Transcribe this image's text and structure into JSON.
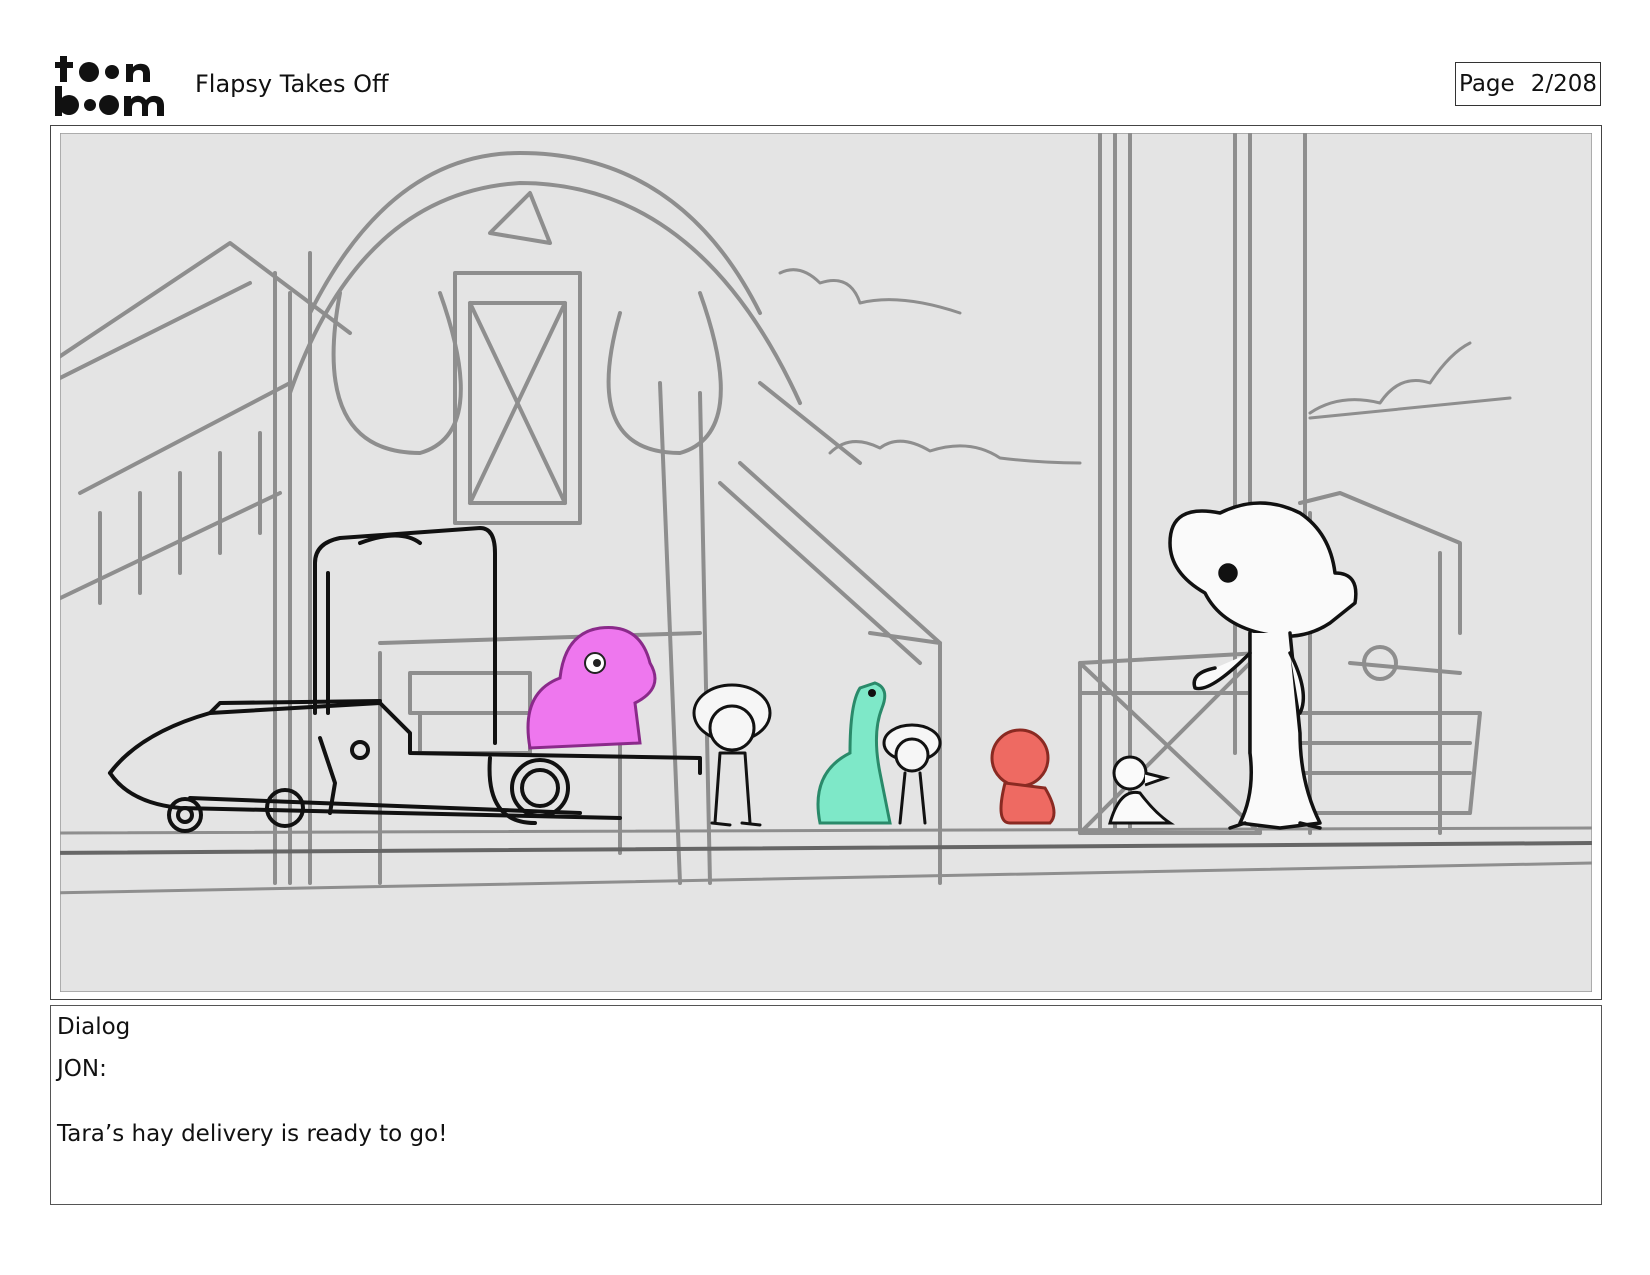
{
  "header": {
    "logo_text_top": "toon",
    "logo_text_bottom": "boom",
    "project_title": "Flapsy Takes Off",
    "page_label": "Page",
    "page_number": "2/208"
  },
  "panel": {
    "background_color": "#e4e4e4",
    "sketch_gray": "#8e8e8e",
    "character_colors": {
      "pink_creature": "#ee77ee",
      "green_dino": "#7ee8c8",
      "red_bird": "#ee6a62"
    }
  },
  "dialog": {
    "heading": "Dialog",
    "speaker": "JON:",
    "line": "Tara’s hay delivery is ready to go!"
  }
}
